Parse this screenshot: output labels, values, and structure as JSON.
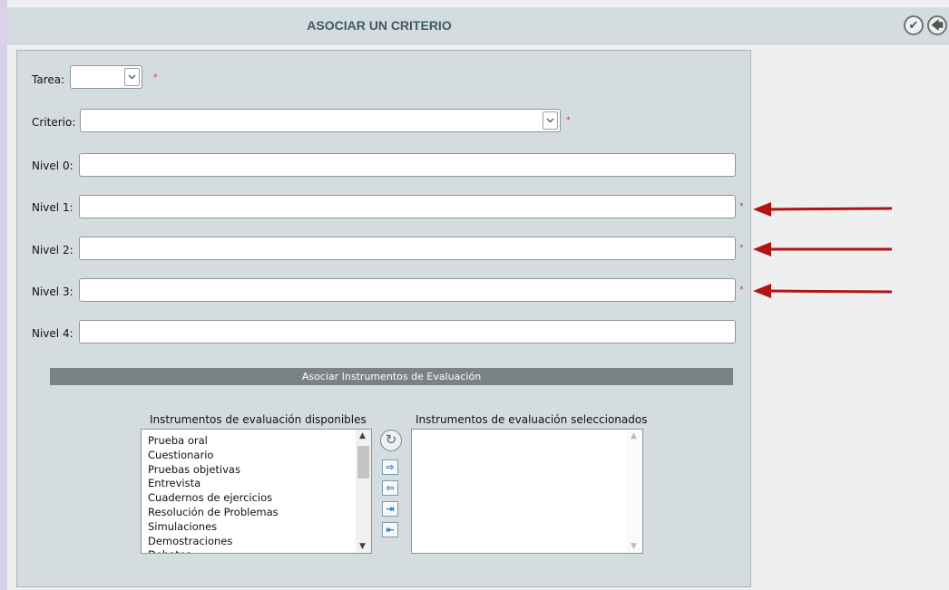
{
  "header": {
    "title": "ASOCIAR UN CRITERIO",
    "confirm_icon": "check-circle-icon",
    "back_icon": "arrow-left-circle-icon"
  },
  "form": {
    "tarea_label": "Tarea:",
    "criterio_label": "Criterio:",
    "nivel0_label": "Nivel 0:",
    "nivel1_label": "Nivel 1:",
    "nivel2_label": "Nivel 2:",
    "nivel3_label": "Nivel 3:",
    "nivel4_label": "Nivel 4:",
    "required_mark": "*"
  },
  "instruments": {
    "section_title": "Asociar Instrumentos de Evaluación",
    "available_title": "Instrumentos de evaluación disponibles",
    "selected_title": "Instrumentos de evaluación seleccionados",
    "available_items": [
      "Prueba oral",
      "Cuestionario",
      "Pruebas objetivas",
      "Entrevista",
      "Cuadernos de ejercicios",
      "Resolución de Problemas",
      "Simulaciones",
      "Demostraciones",
      "Debates"
    ],
    "selected_items": [],
    "controls": {
      "refresh": "↻",
      "add": "⇨",
      "remove": "⇦",
      "add_all": "⇥",
      "remove_all": "⇤"
    }
  },
  "colors": {
    "accent_title": "#3d5a6b",
    "required": "#d92b2b",
    "annotation_arrow": "#b01414",
    "section_bar": "#7a8285"
  }
}
